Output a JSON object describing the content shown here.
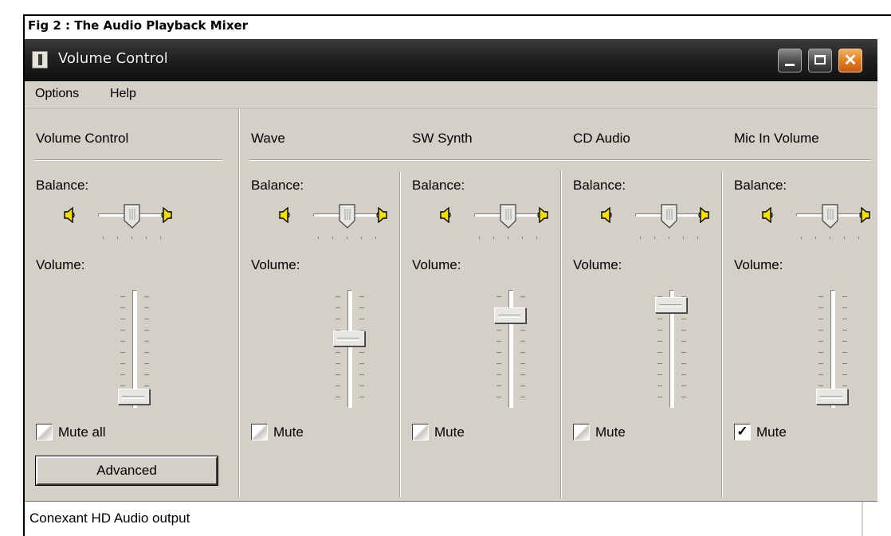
{
  "caption": "Fig 2 : The Audio Playback Mixer",
  "window": {
    "title": "Volume Control",
    "buttons": {
      "minimize": "",
      "maximize": "",
      "close": "✕"
    }
  },
  "menu": {
    "options": "Options",
    "help": "Help"
  },
  "labels": {
    "balance": "Balance:",
    "volume": "Volume:"
  },
  "channels": [
    {
      "name": "Volume Control",
      "mute_label": "Mute all",
      "muted": false,
      "volume_level": 0.03,
      "balance": 0.5
    },
    {
      "name": "Wave",
      "mute_label": "Mute",
      "muted": false,
      "volume_level": 0.6,
      "balance": 0.5
    },
    {
      "name": "SW Synth",
      "mute_label": "Mute",
      "muted": false,
      "volume_level": 0.83,
      "balance": 0.5
    },
    {
      "name": "CD Audio",
      "mute_label": "Mute",
      "muted": false,
      "volume_level": 0.93,
      "balance": 0.5
    },
    {
      "name": "Mic In Volume",
      "mute_label": "Mute",
      "muted": true,
      "volume_level": 0.03,
      "balance": 0.5
    }
  ],
  "advanced_button": "Advanced",
  "status": "Conexant HD Audio output",
  "colors": {
    "titlebar": "#232220",
    "close_button": "#e07a20",
    "face": "#d4d0c8",
    "speaker": "#f3e000"
  }
}
